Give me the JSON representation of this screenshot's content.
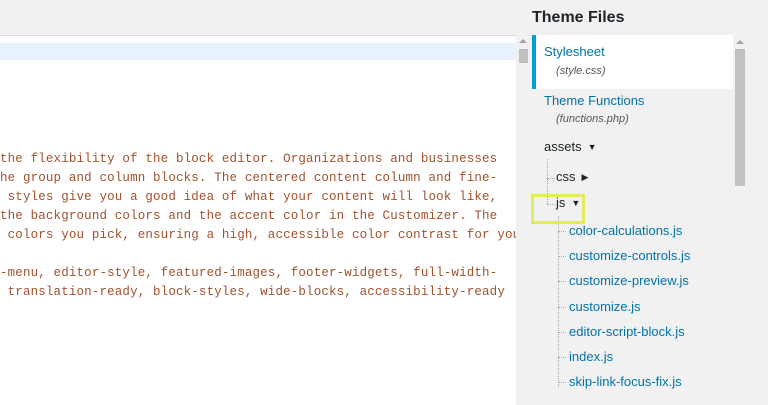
{
  "editor": {
    "lines": [
      "the flexibility of the block editor. Organizations and businesses",
      "he group and column blocks. The centered content column and fine-",
      " styles give you a good idea of what your content will look like,",
      "the background colors and the accent color in the Customizer. The",
      " colors you pick, ensuring a high, accessible color contrast for your",
      "",
      "-menu, editor-style, featured-images, footer-widgets, full-width-",
      " translation-ready, block-styles, wide-blocks, accessibility-ready"
    ]
  },
  "sidebar": {
    "title": "Theme Files",
    "stylesheet": {
      "name": "Stylesheet",
      "file": "(style.css)"
    },
    "functions": {
      "name": "Theme Functions",
      "file": "(functions.php)"
    },
    "assets_label": "assets",
    "css_label": "css",
    "js_label": "js",
    "js_files": [
      "color-calculations.js",
      "customize-controls.js",
      "customize-preview.js",
      "customize.js",
      "editor-script-block.js",
      "index.js",
      "skip-link-focus-fix.js"
    ]
  },
  "colors": {
    "accent": "#00a0d2",
    "link": "#0073aa",
    "code_text": "#a0522d",
    "highlight_box": "#e3ea5e"
  },
  "icons": {
    "expanded": "caret-down-icon",
    "collapsed": "caret-right-icon"
  }
}
